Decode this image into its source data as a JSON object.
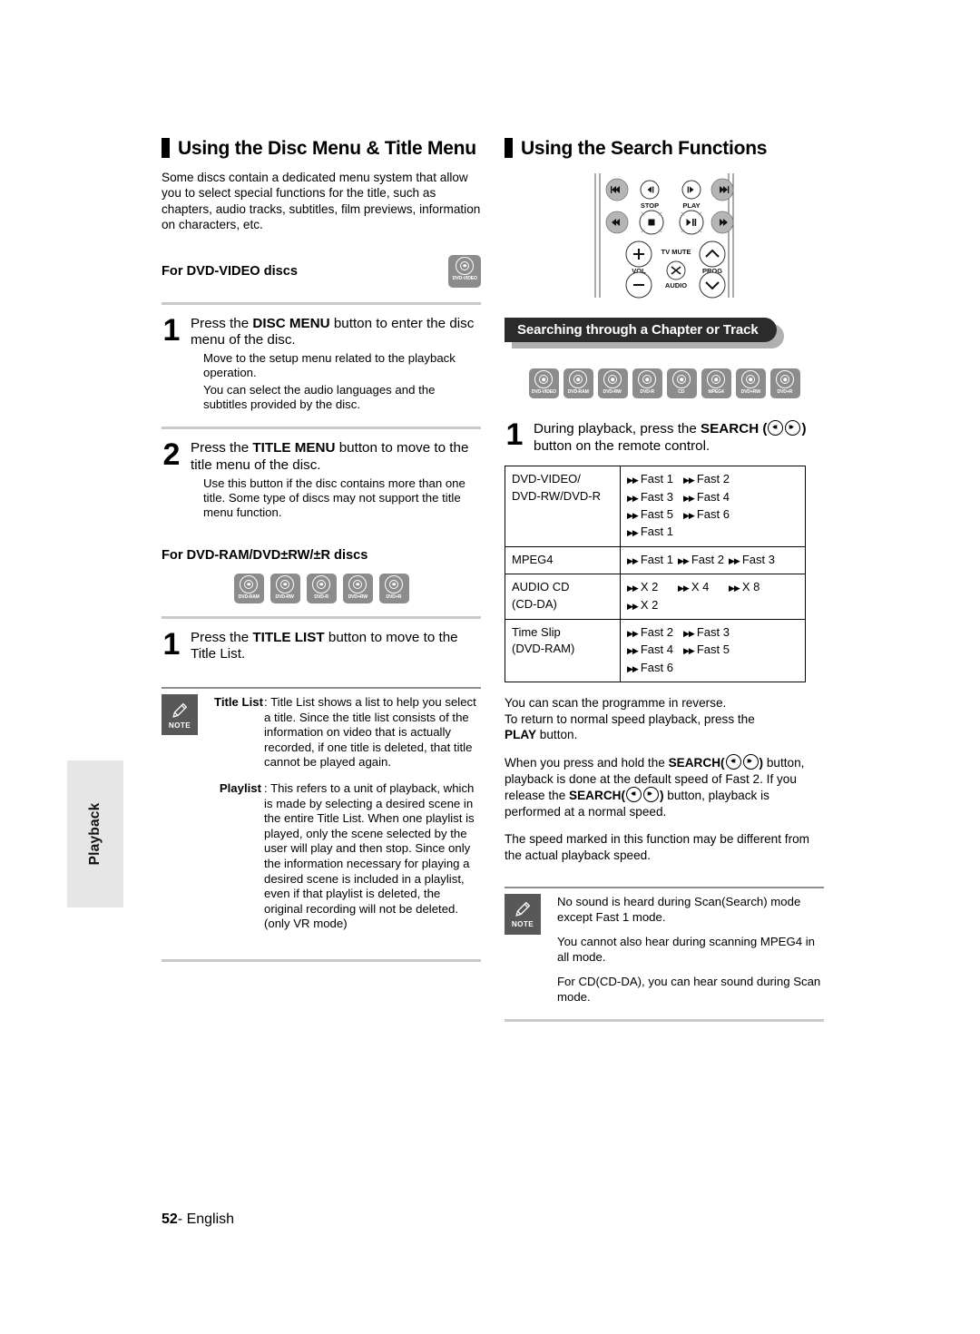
{
  "page": {
    "footer_page_number": "52",
    "footer_separator": "- ",
    "footer_language": "English",
    "side_tab_label": "Playback"
  },
  "left_column": {
    "heading": "Using the Disc Menu & Title Menu",
    "intro": "Some discs contain a dedicated menu system that allow you to select special functions for the title, such as chapters, audio tracks, subtitles, film previews, information on characters, etc.",
    "subhead_dvd_video": "For DVD-VIDEO discs",
    "dvd_video_icon_label": "DVD-VIDEO",
    "steps": [
      {
        "number": "1",
        "main_prefix": "Press the ",
        "main_bold": "DISC MENU",
        "main_suffix": " button to enter the disc menu of the disc.",
        "sub_lines": [
          "Move to the setup menu related to the playback operation.",
          "You can select the audio languages and the subtitles provided by the disc."
        ]
      },
      {
        "number": "2",
        "main_prefix": "Press the ",
        "main_bold": "TITLE MENU",
        "main_suffix": " button to move to the title menu of the disc.",
        "sub_lines": [
          "Use this button if the disc contains more than one title. Some type of discs may not support the title menu function."
        ]
      }
    ],
    "subhead_dvd_ram": "For DVD-RAM/DVD±RW/±R discs",
    "disc_icons": [
      "DVD-RAM",
      "DVD-RW",
      "DVD-R",
      "DVD+RW",
      "DVD+R"
    ],
    "step_title_list": {
      "number": "1",
      "main_prefix": "Press the ",
      "main_bold": "TITLE LIST",
      "main_suffix": " button to move to the Title List."
    },
    "note": {
      "label": "NOTE",
      "definitions": [
        {
          "term": "Title List",
          "definition": ": Title List shows a list to help you select a title. Since the title list consists of the information on video that is actually recorded, if one title is deleted, that title cannot be played again."
        },
        {
          "term": "Playlist",
          "definition": ": This refers to a unit of playback, which is made by selecting a desired scene in the entire Title List. When one playlist is played, only the scene selected by the user will play and then stop. Since only the information necessary for playing a desired scene is included in a playlist, even if that playlist is deleted, the original recording will not be deleted. (only VR mode)"
        }
      ]
    }
  },
  "right_column": {
    "heading": "Using the Search Functions",
    "remote": {
      "labels": {
        "stop": "STOP",
        "play": "PLAY",
        "vol": "VOL",
        "tv_mute": "TV MUTE",
        "audio": "AUDIO",
        "prog": "PROG",
        "plus": "+",
        "minus": "−"
      }
    },
    "banner": "Searching through a Chapter or Track",
    "disc_icons": [
      "DVD-VIDEO",
      "DVD-RAM",
      "DVD-RW",
      "DVD-R",
      "CD",
      "MPEG4",
      "DVD+RW",
      "DVD+R"
    ],
    "step_search": {
      "number": "1",
      "main_prefix": "During playback, press the ",
      "main_bold": "SEARCH",
      "main_suffix": " button on the remote control."
    },
    "speed_table": {
      "rows": [
        {
          "label": "DVD-VIDEO/\nDVD-RW/DVD-R",
          "label_lines": [
            "DVD-VIDEO/",
            "DVD-RW/DVD-R"
          ],
          "speed_lines": [
            [
              "Fast 1",
              "Fast 2"
            ],
            [
              "Fast 3",
              "Fast 4"
            ],
            [
              "Fast 5",
              "Fast 6"
            ],
            [
              "Fast 1"
            ]
          ]
        },
        {
          "label": "MPEG4",
          "label_lines": [
            "MPEG4"
          ],
          "speed_lines": [
            [
              "Fast 1",
              "Fast 2",
              "Fast 3"
            ]
          ]
        },
        {
          "label": "AUDIO CD\n(CD-DA)",
          "label_lines": [
            "AUDIO CD",
            "(CD-DA)"
          ],
          "speed_lines": [
            [
              "X 2",
              "X 4",
              "X 8"
            ],
            [
              "X 2"
            ]
          ]
        },
        {
          "label": "Time Slip\n(DVD-RAM)",
          "label_lines": [
            "Time Slip",
            "(DVD-RAM)"
          ],
          "speed_lines": [
            [
              "Fast 2",
              "Fast 3"
            ],
            [
              "Fast 4",
              "Fast 5"
            ],
            [
              "Fast 6"
            ]
          ]
        }
      ]
    },
    "paragraphs": [
      {
        "parts": [
          {
            "text": "You can scan the programme in reverse.",
            "bold": false,
            "break_after": true
          },
          {
            "text": "To return to normal speed playback, press the ",
            "bold": false,
            "break_after": true
          },
          {
            "text": "PLAY",
            "bold": true
          },
          {
            "text": " button.",
            "bold": false
          }
        ]
      }
    ],
    "paragraph_reverse_l1": "You can scan the programme in reverse.",
    "paragraph_reverse_l2": "To return to normal speed playback, press the ",
    "paragraph_reverse_bold": "PLAY",
    "paragraph_reverse_l3": " button.",
    "paragraph_hold_1": "When you press and hold the ",
    "paragraph_hold_bold1": "SEARCH",
    "paragraph_hold_2": " button, playback is done at the default speed of Fast 2. If you release the ",
    "paragraph_hold_bold2": "SEARCH",
    "paragraph_hold_3": " button, playback is performed at a normal speed.",
    "paragraph_speed": "The speed marked in this function may be different from the actual playback speed.",
    "note": {
      "label": "NOTE",
      "lines": [
        "No sound is heard during Scan(Search) mode except Fast 1 mode.",
        "You cannot also hear during scanning MPEG4 in all mode.",
        "For CD(CD-DA), you can hear sound during Scan mode."
      ]
    }
  },
  "colors": {
    "disc_icon_bg": "#8c8c8c",
    "note_icon_bg": "#585858",
    "banner_bg": "#2b2b2b",
    "banner_shadow": "#b0b0b0",
    "side_tab_bg": "#e6e6e6",
    "rule": "#c9c9c9"
  }
}
